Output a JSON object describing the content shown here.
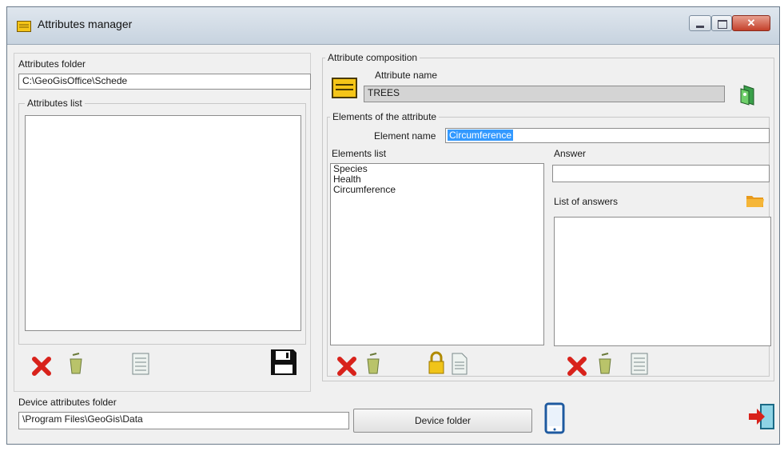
{
  "window": {
    "title": "Attributes manager"
  },
  "left": {
    "folder_label": "Attributes folder",
    "folder_value": "C:\\GeoGisOffice\\Schede",
    "list_label": "Attributes list"
  },
  "composition": {
    "label": "Attribute composition",
    "name_label": "Attribute name",
    "name_value": "TREES",
    "elements_group_label": "Elements of the attribute",
    "element_name_label": "Element name",
    "element_name_value": "Circumference",
    "elements_list_label": "Elements list",
    "elements": [
      "Species",
      "Health",
      "Circumference"
    ],
    "answer_label": "Answer",
    "answer_value": "",
    "answers_list_label": "List of answers"
  },
  "device": {
    "folder_label": "Device attributes folder",
    "folder_value": "\\Program Files\\GeoGis\\Data",
    "button_label": "Device folder"
  },
  "colors": {
    "delete": "#d8221b",
    "folder": "#f5a623",
    "lock": "#f0c419",
    "accent": "#3399ff"
  }
}
